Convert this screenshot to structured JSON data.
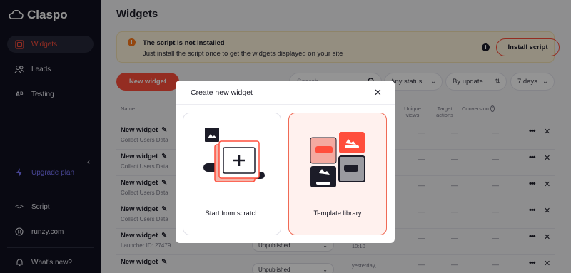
{
  "app": {
    "name": "Claspo"
  },
  "sidebar": {
    "items": [
      {
        "label": "Widgets",
        "icon": "widgets-icon",
        "active": true
      },
      {
        "label": "Leads",
        "icon": "users-icon",
        "active": false
      },
      {
        "label": "Testing",
        "icon": "ab-test-icon",
        "active": false
      }
    ],
    "upgrade_label": "Upgrade plan",
    "script_label": "Script",
    "site_label": "runzy.com",
    "whats_new_label": "What's new?"
  },
  "page": {
    "title": "Widgets"
  },
  "banner": {
    "title": "The script is not installed",
    "subtitle": "Just install the script once to get the widgets displayed on your site",
    "install_label": "Install script"
  },
  "toolbar": {
    "new_widget_label": "New widget",
    "search_placeholder": "Search",
    "status_value": "Any status",
    "sort_value": "By update",
    "period_value": "7 days"
  },
  "table": {
    "headers": {
      "name": "Name",
      "unique_views": "Unique views",
      "target_actions": "Target actions",
      "conversion": "Conversion"
    },
    "rows": [
      {
        "name": "New widget",
        "type": "Collect Users Data"
      },
      {
        "name": "New widget",
        "type": "Collect Users Data"
      },
      {
        "name": "New widget",
        "type": "Collect Users Data"
      },
      {
        "name": "New widget",
        "type": "Collect Users Data"
      },
      {
        "name": "New widget",
        "type": "Launcher  ID: 27479",
        "status": "Unpublished",
        "updated": "10:10"
      },
      {
        "name": "New widget",
        "type": "",
        "status": "Unpublished",
        "updated": "yesterday,"
      }
    ],
    "dash": "—"
  },
  "modal": {
    "title": "Create new widget",
    "cards": [
      {
        "label": "Start from scratch"
      },
      {
        "label": "Template library"
      }
    ]
  },
  "colors": {
    "accent": "#ff4e3c",
    "sidebar": "#10111f",
    "upgrade": "#7b77ff"
  }
}
